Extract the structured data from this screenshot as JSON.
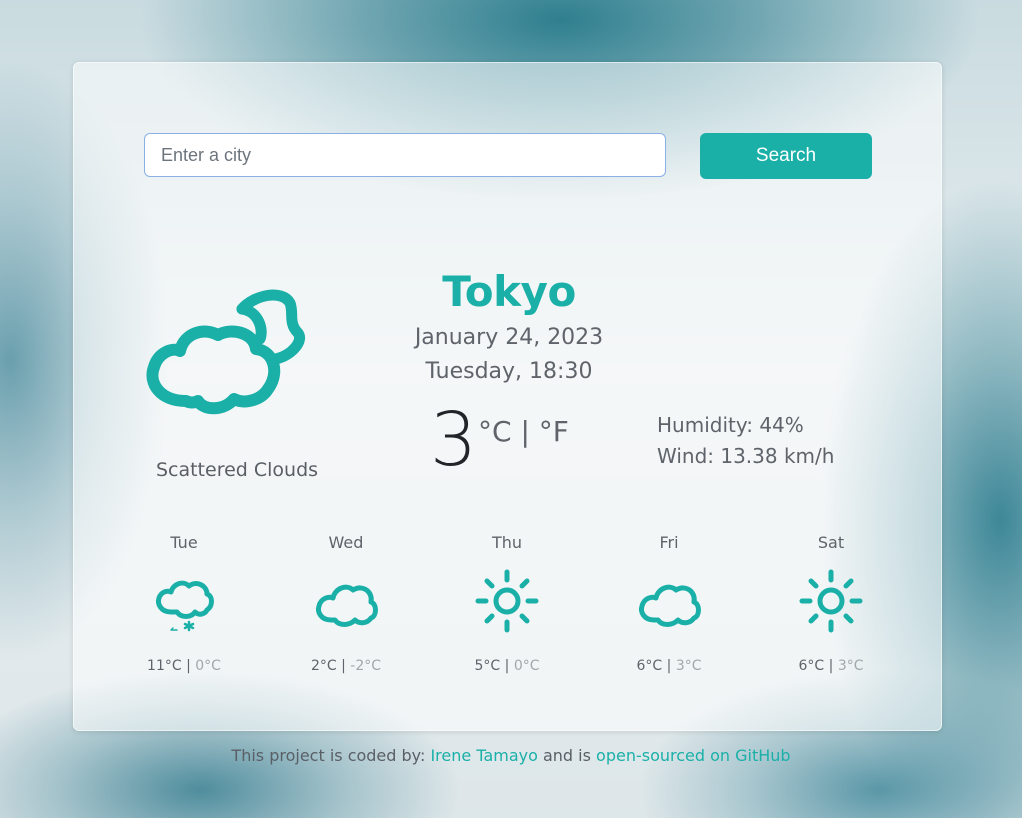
{
  "search": {
    "placeholder": "Enter a city",
    "value": "",
    "button_label": "Search"
  },
  "current": {
    "city": "Tokyo",
    "date": "January 24, 2023",
    "day_time": "Tuesday, 18:30",
    "temperature": "3",
    "units": "°C | °F",
    "description": "Scattered Clouds",
    "humidity": "Humidity: 44%",
    "wind": "Wind: 13.38 km/h",
    "icon": "cloud-moon-icon"
  },
  "forecast": [
    {
      "day": "Tue",
      "max": "11°C",
      "min": "0°C",
      "icon": "cloud-snow-icon"
    },
    {
      "day": "Wed",
      "max": "2°C",
      "min": "-2°C",
      "icon": "cloud-icon"
    },
    {
      "day": "Thu",
      "max": "5°C",
      "min": "0°C",
      "icon": "sun-icon"
    },
    {
      "day": "Fri",
      "max": "6°C",
      "min": "3°C",
      "icon": "cloud-icon"
    },
    {
      "day": "Sat",
      "max": "6°C",
      "min": "3°C",
      "icon": "sun-icon"
    }
  ],
  "forecast_separator": "|",
  "footer": {
    "prefix": "This project is coded by: ",
    "author": "Irene Tamayo",
    "middle": " and is ",
    "repo_link": "open-sourced on GitHub"
  },
  "colors": {
    "accent": "#1ab0a8",
    "text": "#5f646b",
    "muted": "#a3a7ab"
  }
}
